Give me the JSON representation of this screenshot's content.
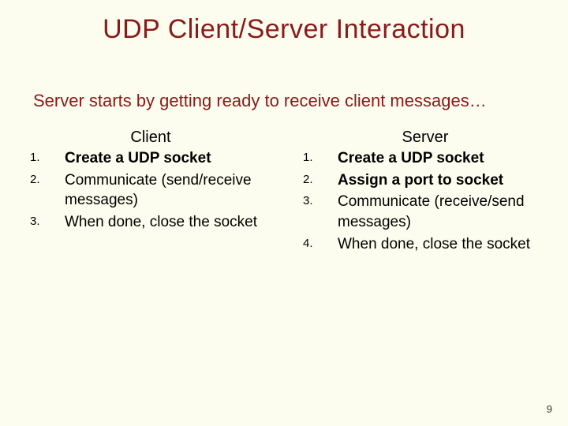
{
  "title": "UDP Client/Server Interaction",
  "subtitle": "Server starts by getting ready to receive client messages…",
  "client": {
    "heading": "Client",
    "steps": [
      {
        "n": "1.",
        "text": "Create a UDP socket"
      },
      {
        "n": "2.",
        "text": "Communicate (send/receive messages)"
      },
      {
        "n": "3.",
        "text": "When done, close the socket"
      }
    ]
  },
  "server": {
    "heading": "Server",
    "steps": [
      {
        "n": "1.",
        "text": "Create a UDP socket"
      },
      {
        "n": "2.",
        "text": "Assign a port to socket"
      },
      {
        "n": "3.",
        "text": "Communicate (receive/send messages)"
      },
      {
        "n": "4.",
        "text": "When done, close the socket"
      }
    ]
  },
  "page_number": "9"
}
